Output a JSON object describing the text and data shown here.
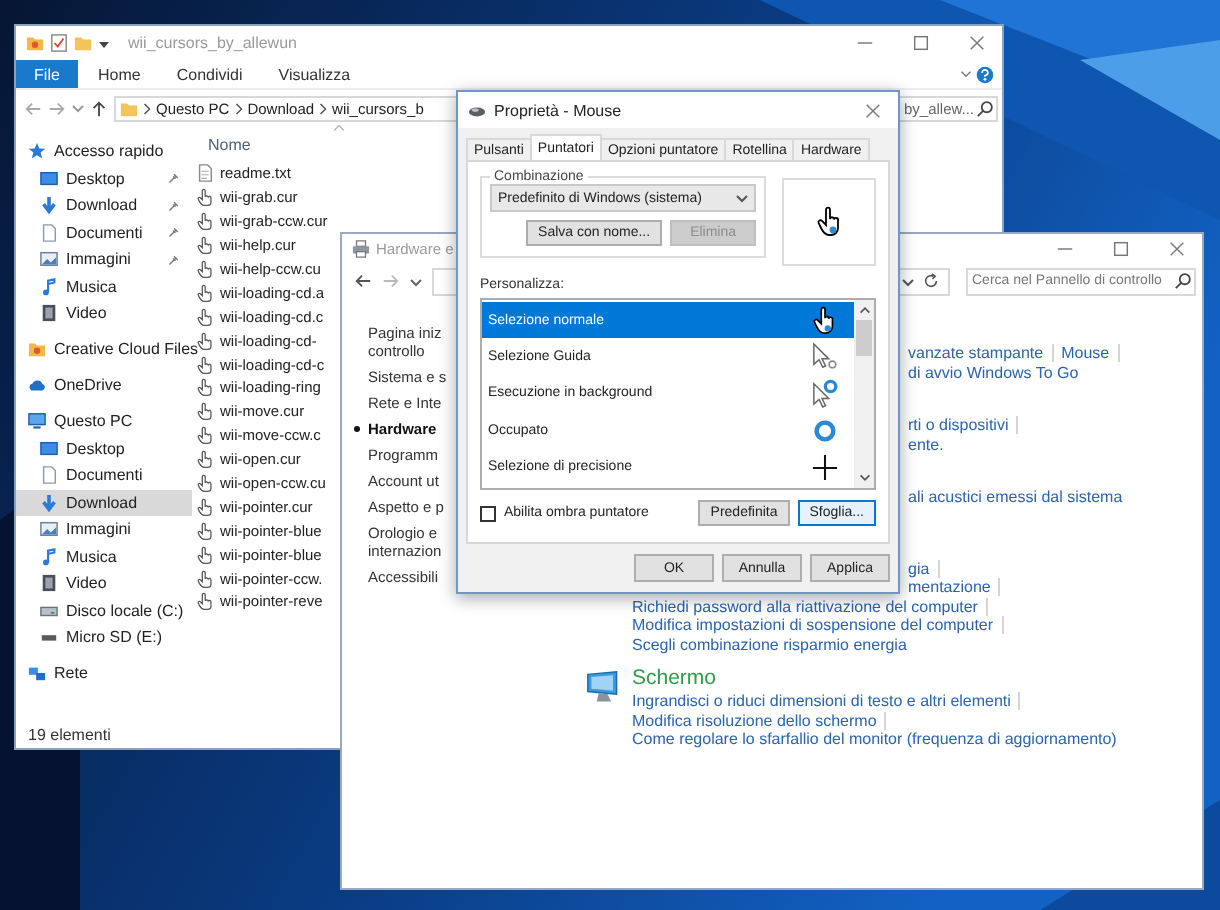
{
  "explorer": {
    "title": "wii_cursors_by_allewun",
    "file_menu": "File",
    "ribbon_tabs": [
      "Home",
      "Condividi",
      "Visualizza"
    ],
    "path": [
      "Questo PC",
      "Download",
      "wii_cursors_b"
    ],
    "search": {
      "placeholder": "by_allew..."
    },
    "nav": [
      {
        "label": "Accesso rapido",
        "selected": false,
        "children": [
          {
            "label": "Desktop",
            "pinned": true,
            "selected": false
          },
          {
            "label": "Download",
            "pinned": true,
            "selected": false
          },
          {
            "label": "Documenti",
            "pinned": true,
            "selected": false
          },
          {
            "label": "Immagini",
            "pinned": true,
            "selected": false
          },
          {
            "label": "Musica",
            "pinned": false,
            "selected": false
          },
          {
            "label": "Video",
            "pinned": false,
            "selected": false
          }
        ]
      },
      {
        "label": "Creative Cloud Files",
        "selected": false
      },
      {
        "label": "OneDrive",
        "selected": false
      },
      {
        "label": "Questo PC",
        "selected": false,
        "children": [
          {
            "label": "Desktop",
            "selected": false
          },
          {
            "label": "Documenti",
            "selected": false
          },
          {
            "label": "Download",
            "selected": true
          },
          {
            "label": "Immagini",
            "selected": false
          },
          {
            "label": "Musica",
            "selected": false
          },
          {
            "label": "Video",
            "selected": false
          },
          {
            "label": "Disco locale (C:)",
            "selected": false
          },
          {
            "label": "Micro SD (E:)",
            "selected": false
          }
        ]
      },
      {
        "label": "Rete",
        "selected": false
      }
    ],
    "column_header": "Nome",
    "files": [
      "readme.txt",
      "wii-grab.cur",
      "wii-grab-ccw.cur",
      "wii-help.cur",
      "wii-help-ccw.cu",
      "wii-loading-cd.a",
      "wii-loading-cd.c",
      "wii-loading-cd-",
      "wii-loading-cd-c",
      "wii-loading-ring",
      "wii-move.cur",
      "wii-move-ccw.c",
      "wii-open.cur",
      "wii-open-ccw.cu",
      "wii-pointer.cur",
      "wii-pointer-blue",
      "wii-pointer-blue",
      "wii-pointer-ccw.",
      "wii-pointer-reve"
    ],
    "status": "19 elementi"
  },
  "control_panel": {
    "title": "Hardware e",
    "search": {
      "placeholder": "Cerca nel Pannello di controllo"
    },
    "nav": [
      {
        "lines": [
          "Pagina iniz",
          "controllo"
        ],
        "selected": false
      },
      {
        "lines": [
          "Sistema e s"
        ],
        "selected": false
      },
      {
        "lines": [
          "Rete e Inte"
        ],
        "selected": false
      },
      {
        "lines": [
          "Hardware"
        ],
        "selected": true
      },
      {
        "lines": [
          "Programm"
        ],
        "selected": false
      },
      {
        "lines": [
          "Account ut"
        ],
        "selected": false
      },
      {
        "lines": [
          "Aspetto e p"
        ],
        "selected": false
      },
      {
        "lines": [
          "Orologio e",
          "internazion"
        ],
        "selected": false
      },
      {
        "lines": [
          "Accessibili"
        ],
        "selected": false
      }
    ],
    "partial_groups": [
      [
        [
          "vanzate stampante",
          "Mouse"
        ],
        [
          "di avvio Windows To Go"
        ]
      ],
      [
        [
          "rti o dispositivi"
        ],
        [
          "ente."
        ]
      ],
      [
        [
          "ali acustici emessi dal sistema"
        ]
      ]
    ],
    "energy_partial": [
      "gia",
      "mentazione"
    ],
    "energy_links": [
      "Richiedi password alla riattivazione del computer",
      "Modifica impostazioni di sospensione del computer",
      "Scegli combinazione risparmio energia"
    ],
    "display": {
      "heading": "Schermo",
      "links": [
        "Ingrandisci o riduci dimensioni di testo e altri elementi",
        "Modifica risoluzione dello schermo",
        "Come regolare lo sfarfallio del monitor (frequenza di aggiornamento)"
      ]
    }
  },
  "mouse_dialog": {
    "title": "Proprietà - Mouse",
    "tabs": [
      {
        "label": "Pulsanti",
        "selected": false
      },
      {
        "label": "Puntatori",
        "selected": true
      },
      {
        "label": "Opzioni puntatore",
        "selected": false
      },
      {
        "label": "Rotellina",
        "selected": false
      },
      {
        "label": "Hardware",
        "selected": false
      }
    ],
    "scheme_label": "Combinazione",
    "scheme": "Predefinito di Windows (sistema)",
    "save_button": "Salva con nome...",
    "delete_button": {
      "label": "Elimina",
      "disabled": true
    },
    "customize_label": "Personalizza:",
    "cursors": [
      {
        "name": "Selezione normale",
        "selected": true
      },
      {
        "name": "Selezione Guida",
        "selected": false
      },
      {
        "name": "Esecuzione in background",
        "selected": false
      },
      {
        "name": "Occupato",
        "selected": false
      },
      {
        "name": "Selezione di precisione",
        "selected": false
      }
    ],
    "shadow": {
      "label": "Abilita ombra puntatore",
      "checked": false
    },
    "default_button": "Predefinita",
    "browse_button": "Sfoglia...",
    "footer_buttons": [
      "OK",
      "Annulla",
      "Applica"
    ]
  }
}
